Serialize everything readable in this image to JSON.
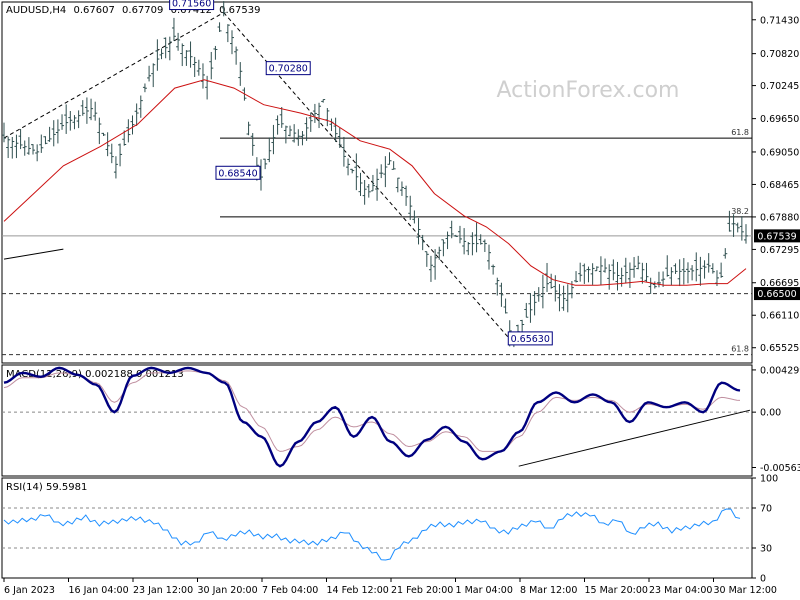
{
  "chart_data": [
    {
      "type": "candlestick",
      "title": "AUDUSD,H4",
      "ohlc": {
        "open": "0.67607",
        "high": "0.67709",
        "low": "0.67412",
        "close": "0.67539"
      },
      "watermark": "ActionForex.com",
      "ylim": [
        0.6525,
        0.7175
      ],
      "y_ticks": [
        "0.71430",
        "0.70820",
        "0.70245",
        "0.69650",
        "0.69050",
        "0.68465",
        "0.67880",
        "0.67295",
        "0.66695",
        "0.66110",
        "0.65525"
      ],
      "x_ticks": [
        "6 Jan 2023",
        "16 Jan 04:00",
        "23 Jan 12:00",
        "30 Jan 20:00",
        "7 Feb 04:00",
        "14 Feb 12:00",
        "21 Feb 20:00",
        "1 Mar 04:00",
        "8 Mar 12:00",
        "15 Mar 20:00",
        "23 Mar 04:00",
        "30 Mar 12:00"
      ],
      "close_points": [
        {
          "x": 0,
          "y": 0.693
        },
        {
          "x": 0.045,
          "y": 0.6905
        },
        {
          "x": 0.08,
          "y": 0.6955
        },
        {
          "x": 0.12,
          "y": 0.6985
        },
        {
          "x": 0.15,
          "y": 0.688
        },
        {
          "x": 0.175,
          "y": 0.696
        },
        {
          "x": 0.2,
          "y": 0.706
        },
        {
          "x": 0.23,
          "y": 0.7115
        },
        {
          "x": 0.255,
          "y": 0.707
        },
        {
          "x": 0.275,
          "y": 0.703
        },
        {
          "x": 0.296,
          "y": 0.7156
        },
        {
          "x": 0.315,
          "y": 0.708
        },
        {
          "x": 0.33,
          "y": 0.695
        },
        {
          "x": 0.345,
          "y": 0.6854
        },
        {
          "x": 0.37,
          "y": 0.696
        },
        {
          "x": 0.4,
          "y": 0.693
        },
        {
          "x": 0.43,
          "y": 0.7
        },
        {
          "x": 0.46,
          "y": 0.689
        },
        {
          "x": 0.49,
          "y": 0.683
        },
        {
          "x": 0.52,
          "y": 0.689
        },
        {
          "x": 0.55,
          "y": 0.68
        },
        {
          "x": 0.575,
          "y": 0.67
        },
        {
          "x": 0.6,
          "y": 0.676
        },
        {
          "x": 0.625,
          "y": 0.674
        },
        {
          "x": 0.65,
          "y": 0.674
        },
        {
          "x": 0.67,
          "y": 0.665
        },
        {
          "x": 0.685,
          "y": 0.6563
        },
        {
          "x": 0.705,
          "y": 0.661
        },
        {
          "x": 0.73,
          "y": 0.667
        },
        {
          "x": 0.755,
          "y": 0.664
        },
        {
          "x": 0.78,
          "y": 0.669
        },
        {
          "x": 0.805,
          "y": 0.67
        },
        {
          "x": 0.83,
          "y": 0.668
        },
        {
          "x": 0.855,
          "y": 0.6705
        },
        {
          "x": 0.875,
          "y": 0.666
        },
        {
          "x": 0.9,
          "y": 0.669
        },
        {
          "x": 0.925,
          "y": 0.669
        },
        {
          "x": 0.95,
          "y": 0.67
        },
        {
          "x": 0.965,
          "y": 0.667
        },
        {
          "x": 0.98,
          "y": 0.678
        },
        {
          "x": 1,
          "y": 0.67539
        }
      ],
      "moving_average": [
        {
          "x": 0,
          "y": 0.678
        },
        {
          "x": 0.04,
          "y": 0.683
        },
        {
          "x": 0.08,
          "y": 0.688
        },
        {
          "x": 0.13,
          "y": 0.6915
        },
        {
          "x": 0.18,
          "y": 0.6955
        },
        {
          "x": 0.23,
          "y": 0.702
        },
        {
          "x": 0.27,
          "y": 0.7035
        },
        {
          "x": 0.31,
          "y": 0.702
        },
        {
          "x": 0.35,
          "y": 0.699
        },
        {
          "x": 0.4,
          "y": 0.6975
        },
        {
          "x": 0.44,
          "y": 0.696
        },
        {
          "x": 0.48,
          "y": 0.6925
        },
        {
          "x": 0.52,
          "y": 0.691
        },
        {
          "x": 0.55,
          "y": 0.688
        },
        {
          "x": 0.58,
          "y": 0.683
        },
        {
          "x": 0.62,
          "y": 0.679
        },
        {
          "x": 0.65,
          "y": 0.677
        },
        {
          "x": 0.68,
          "y": 0.674
        },
        {
          "x": 0.71,
          "y": 0.67
        },
        {
          "x": 0.74,
          "y": 0.6675
        },
        {
          "x": 0.77,
          "y": 0.6665
        },
        {
          "x": 0.8,
          "y": 0.6665
        },
        {
          "x": 0.83,
          "y": 0.6668
        },
        {
          "x": 0.86,
          "y": 0.6672
        },
        {
          "x": 0.89,
          "y": 0.6665
        },
        {
          "x": 0.92,
          "y": 0.6665
        },
        {
          "x": 0.95,
          "y": 0.6668
        },
        {
          "x": 0.975,
          "y": 0.6668
        },
        {
          "x": 1,
          "y": 0.6695
        }
      ],
      "horizontal_levels": [
        {
          "value": 0.693,
          "label": "61.8",
          "style": "solid"
        },
        {
          "value": 0.6788,
          "label": "38.2",
          "style": "solid"
        },
        {
          "value": 0.67539,
          "label": "",
          "style": "grey"
        },
        {
          "value": 0.665,
          "label": "",
          "style": "dashed"
        },
        {
          "value": 0.654,
          "label": "61.8",
          "style": "dashed"
        }
      ],
      "price_badges": [
        "0.67539",
        "0.66500"
      ],
      "annotations": [
        {
          "label": "0.71560",
          "x": 0.296,
          "y": 0.7156
        },
        {
          "label": "0.70280",
          "x": 0.41,
          "y": 0.7028
        },
        {
          "label": "0.68540",
          "x": 0.345,
          "y": 0.6854
        },
        {
          "label": "0.65630",
          "x": 0.685,
          "y": 0.6563
        }
      ],
      "trendlines": [
        {
          "from": {
            "x": 0,
            "y": 0.693
          },
          "to": {
            "x": 0.296,
            "y": 0.7156
          },
          "style": "dashed"
        },
        {
          "from": {
            "x": 0.296,
            "y": 0.7156
          },
          "to": {
            "x": 0.685,
            "y": 0.6563
          },
          "style": "dashed"
        },
        {
          "from": {
            "x": 0,
            "y": 0.6712
          },
          "to": {
            "x": 0.08,
            "y": 0.673
          },
          "style": "solid"
        }
      ]
    },
    {
      "type": "line",
      "title": "MACD(12,26,9) 0.002188 0.001213",
      "ylim": [
        -0.0065,
        0.0048
      ],
      "y_ticks": [
        "0.004299",
        "0.00",
        "-0.005636"
      ],
      "series": [
        {
          "values": [
            0.003,
            0.004,
            0.0036,
            0.0045,
            0.0038,
            0.0028,
            0.0,
            0.0037,
            0.0045,
            0.004,
            0.0045,
            0.004,
            0.003,
            -0.001,
            -0.0025,
            -0.0055,
            -0.003,
            -0.001,
            0.0005,
            -0.0025,
            -0.0005,
            -0.003,
            -0.0045,
            -0.0028,
            -0.0015,
            -0.003,
            -0.0048,
            -0.004,
            -0.002,
            0.001,
            0.002,
            0.001,
            0.0018,
            0.001,
            -0.001,
            0.001,
            0.0005,
            0.001,
            0.0,
            0.003,
            0.0022
          ]
        },
        {
          "values": [
            0.0025,
            0.0035,
            0.0035,
            0.004,
            0.0038,
            0.003,
            0.001,
            0.003,
            0.004,
            0.004,
            0.0042,
            0.004,
            0.0032,
            0.0005,
            -0.0015,
            -0.004,
            -0.0035,
            -0.0018,
            -0.0005,
            -0.0015,
            -0.001,
            -0.0022,
            -0.0035,
            -0.003,
            -0.002,
            -0.0025,
            -0.004,
            -0.004,
            -0.0025,
            0.0,
            0.0015,
            0.0012,
            0.0015,
            0.0012,
            0.0,
            0.0008,
            0.0005,
            0.0008,
            0.0003,
            0.0015,
            0.0012
          ]
        }
      ],
      "trendline": {
        "from": {
          "x": 0.69,
          "y": -0.0055
        },
        "to": {
          "x": 1,
          "y": 0.0002
        }
      }
    },
    {
      "type": "line",
      "title": "RSI(14) 59.5981",
      "ylim": [
        0,
        100
      ],
      "y_ticks": [
        "100",
        "70",
        "30",
        "0"
      ],
      "levels": [
        70,
        30
      ],
      "series": [
        {
          "values": [
            58,
            55,
            60,
            62,
            56,
            54,
            63,
            52,
            58,
            57,
            61,
            54,
            48,
            33,
            36,
            45,
            40,
            42,
            48,
            39,
            44,
            35,
            38,
            33,
            41,
            45,
            36,
            25,
            18,
            30,
            40,
            48,
            56,
            51,
            58,
            56,
            50,
            44,
            54,
            56,
            50,
            59,
            66,
            62,
            55,
            57,
            45,
            50,
            56,
            45,
            52,
            52,
            57,
            69,
            59.6
          ]
        }
      ]
    }
  ]
}
